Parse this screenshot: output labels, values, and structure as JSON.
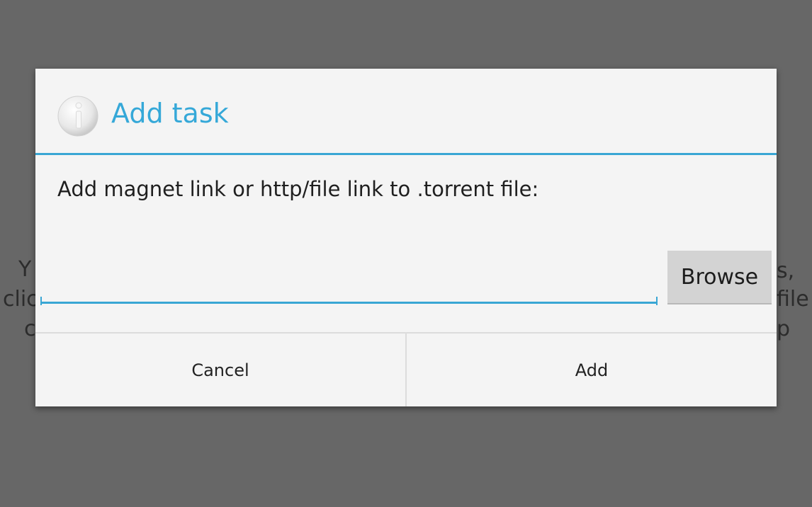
{
  "background": {
    "fragments_left": [
      "Y",
      "clic",
      "c"
    ],
    "fragments_right": [
      "s,",
      "file",
      "p"
    ]
  },
  "dialog": {
    "icon": "info-icon",
    "title": "Add task",
    "message": "Add magnet link or http/file link to .torrent file:",
    "input": {
      "value": "",
      "placeholder": ""
    },
    "browse_label": "Browse",
    "buttons": {
      "cancel_label": "Cancel",
      "add_label": "Add"
    }
  },
  "colors": {
    "overlay": "#676767",
    "dialog_bg": "#f4f4f4",
    "accent": "#39a6d4",
    "title": "#35a8d8",
    "browse_bg": "#d3d3d3"
  }
}
